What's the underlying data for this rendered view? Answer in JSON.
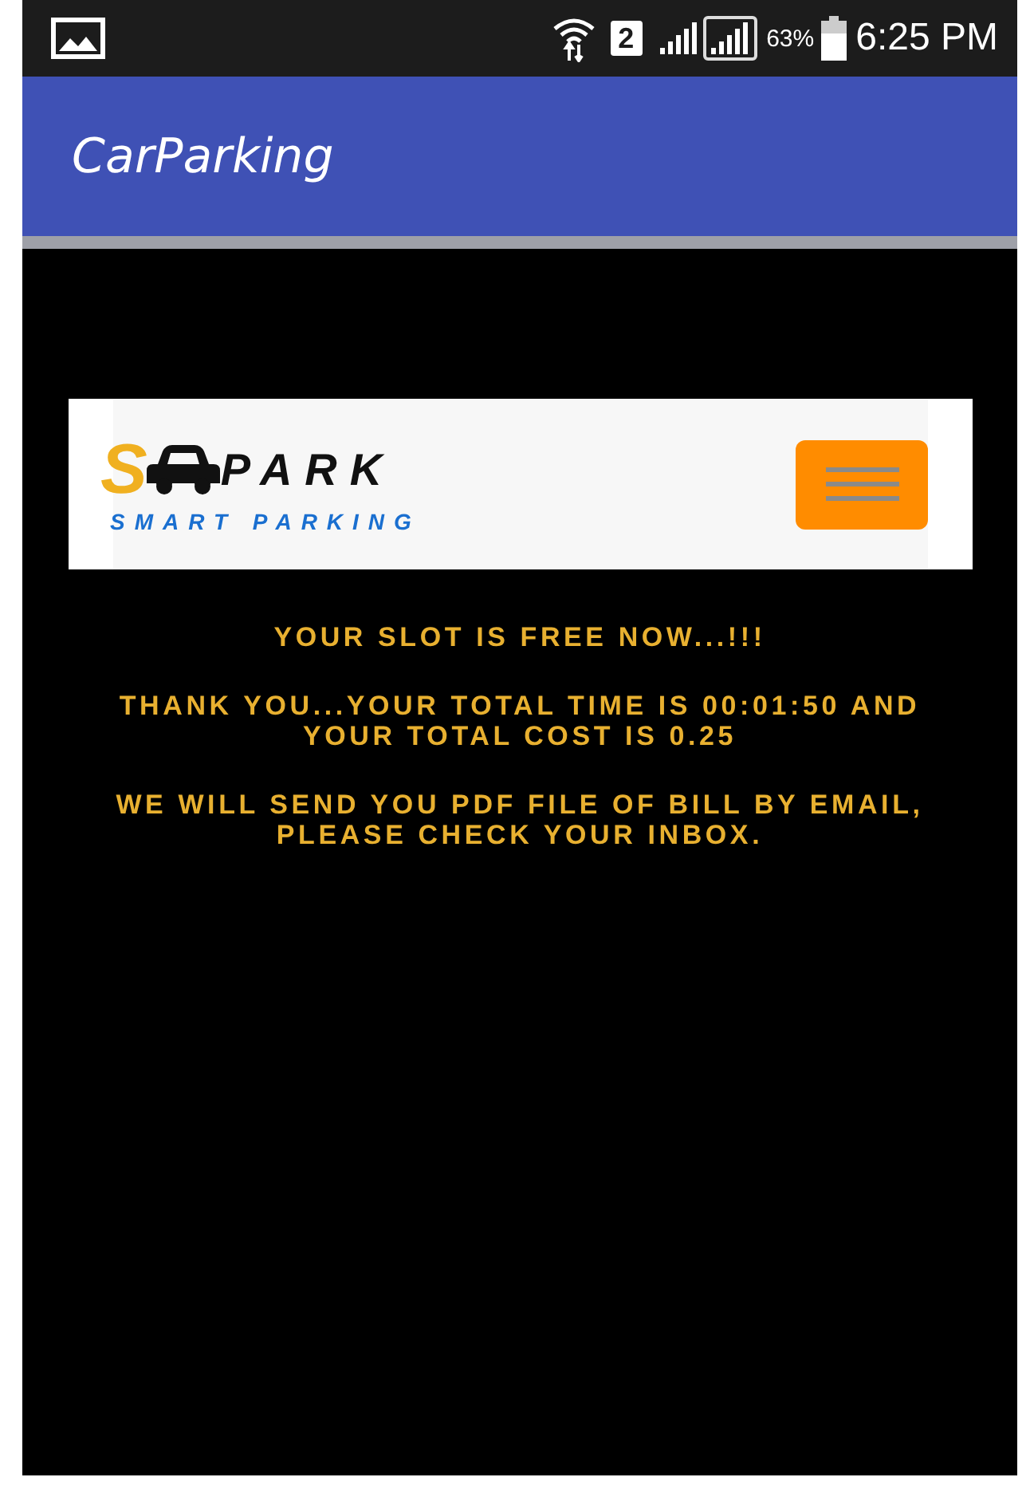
{
  "status_bar": {
    "sim_slot": "2",
    "battery_percent": "63%",
    "time": "6:25 PM"
  },
  "app_bar": {
    "title": "CarParking"
  },
  "site_header": {
    "logo": {
      "letter": "S",
      "word": "PARK",
      "tagline": "SMART PARKING"
    }
  },
  "messages": [
    "YOUR SLOT IS FREE NOW...!!!",
    "THANK YOU...YOUR TOTAL TIME IS 00:01:50 AND YOUR TOTAL COST IS 0.25",
    "WE WILL SEND YOU PDF FILE OF BILL BY EMAIL, PLEASE CHECK YOUR INBOX."
  ]
}
